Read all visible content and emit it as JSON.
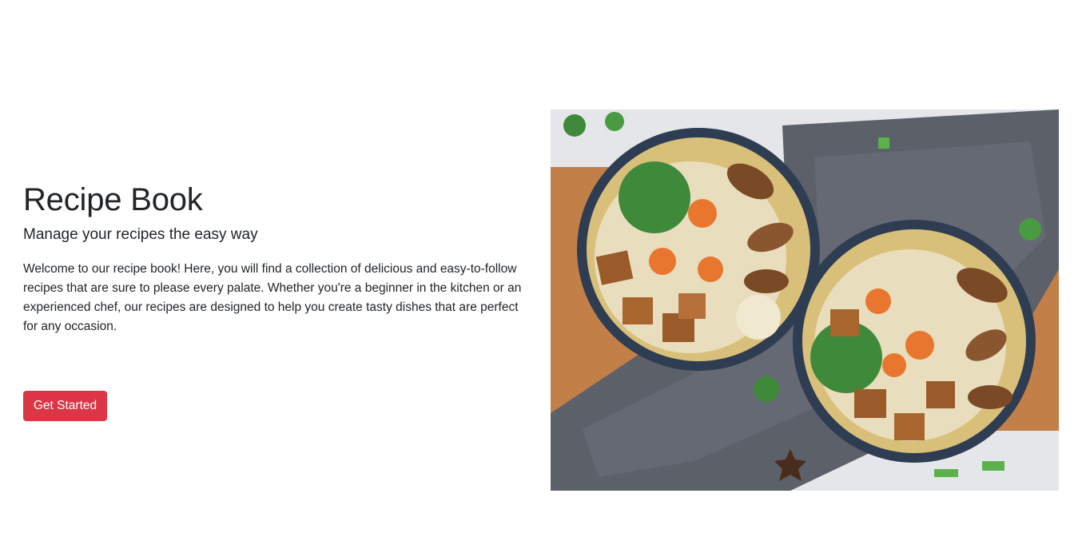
{
  "hero": {
    "title": "Recipe Book",
    "subtitle": "Manage your recipes the easy way",
    "description": "Welcome to our recipe book! Here, you will find a collection of delicious and easy-to-follow recipes that are sure to please every palate. Whether you're a beginner in the kitchen or an experienced chef, our recipes are designed to help you create tasty dishes that are perfect for any occasion.",
    "cta_label": "Get Started",
    "cta_color": "#dc3545"
  },
  "image": {
    "subject": "two bowls of noodle soup with tofu, mushrooms, carrots and herbs on a wooden board with a grey cloth"
  }
}
